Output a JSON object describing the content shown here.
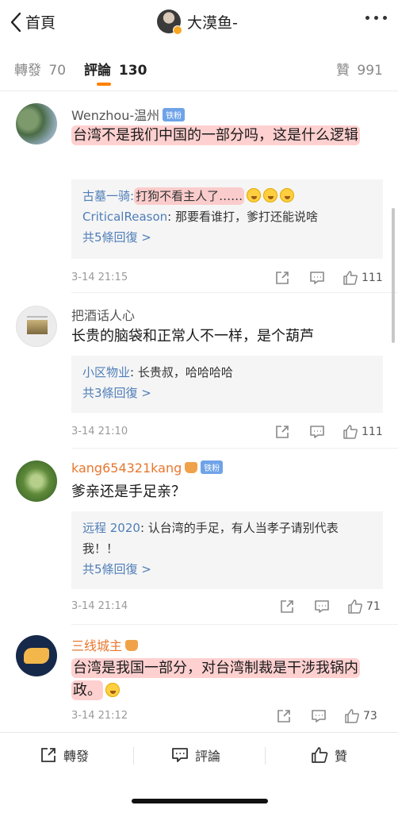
{
  "header": {
    "back_label": "首頁",
    "title": "大漠鱼-"
  },
  "tabs": [
    {
      "label": "轉發",
      "count": "70"
    },
    {
      "label": "評論",
      "count": "130"
    },
    {
      "label": "贊",
      "count": "991"
    }
  ],
  "comments": [
    {
      "user": "Wenzhou-温州",
      "badge": "铁粉",
      "text": "台湾不是我们中国的一部分吗，这是什么逻辑",
      "replies": [
        {
          "user": "古墓一骑",
          "text": "打狗不看主人了……"
        },
        {
          "user": "CriticalReason",
          "text": "那要看谁打，爹打还能说啥"
        }
      ],
      "more": "共5條回復 >",
      "time": "3-14 21:15",
      "likes": "111"
    },
    {
      "user": "把酒话人心",
      "text": "长贵的脑袋和正常人不一样，是个葫芦",
      "replies": [
        {
          "user": "小区物业",
          "text": "长贵叔，哈哈哈哈"
        }
      ],
      "more": "共3條回復 >",
      "time": "3-14 21:10",
      "likes": "111"
    },
    {
      "user": "kang654321kang",
      "badge": "铁粉",
      "text": "爹亲还是手足亲？",
      "replies": [
        {
          "user": "远程 2020",
          "text": "认台湾的手足，有人当孝子请别代表我！！"
        }
      ],
      "more": "共5條回復 >",
      "time": "3-14 21:14",
      "likes": "71"
    },
    {
      "user": "三线城主",
      "text": "台湾是我国一部分，对台湾制裁是干涉我锅内政。",
      "time": "3-14 21:12",
      "likes": "73"
    }
  ],
  "bottom_bar": {
    "repost": "轉發",
    "comment": "評論",
    "like": "贊"
  },
  "colors": {
    "accent": "#ff8200",
    "link": "#4f7eb8",
    "highlight": "#ffaaaa",
    "username_orange": "#e8772e"
  },
  "icons": [
    "back-chevron-icon",
    "more-dots-icon",
    "share-icon",
    "comment-icon",
    "like-icon",
    "emoji-laugh-icon"
  ]
}
